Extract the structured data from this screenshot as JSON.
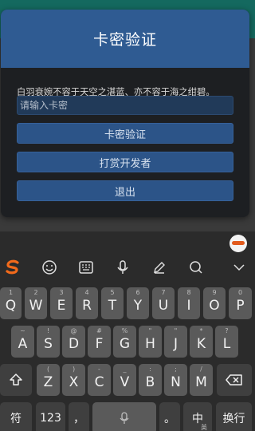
{
  "dialog": {
    "title": "卡密验证",
    "message": "白羽衰婉不容于天空之湛蓝、亦不容于海之绀碧。",
    "input_placeholder": "请输入卡密",
    "buttons": {
      "verify": "卡密验证",
      "reward": "打赏开发者",
      "exit": "退出"
    }
  },
  "keyboard": {
    "toolbar_icons": [
      "sogou-logo-icon",
      "emoji-icon",
      "keyboard-icon",
      "microphone-icon",
      "pen-icon",
      "search-icon",
      "chevron-down-icon"
    ],
    "row1": [
      {
        "key": "Q",
        "sub": "1"
      },
      {
        "key": "W",
        "sub": "2"
      },
      {
        "key": "E",
        "sub": "3"
      },
      {
        "key": "R",
        "sub": "4"
      },
      {
        "key": "T",
        "sub": "5"
      },
      {
        "key": "Y",
        "sub": "6"
      },
      {
        "key": "U",
        "sub": "7"
      },
      {
        "key": "I",
        "sub": "8"
      },
      {
        "key": "O",
        "sub": "9"
      },
      {
        "key": "P",
        "sub": "0"
      }
    ],
    "row2": [
      {
        "key": "A",
        "sub": "~"
      },
      {
        "key": "S",
        "sub": "!"
      },
      {
        "key": "D",
        "sub": "@"
      },
      {
        "key": "F",
        "sub": "#"
      },
      {
        "key": "G",
        "sub": "%"
      },
      {
        "key": "H",
        "sub": "\""
      },
      {
        "key": "J",
        "sub": "\""
      },
      {
        "key": "K",
        "sub": "*"
      },
      {
        "key": "L",
        "sub": "?"
      }
    ],
    "row3": [
      {
        "key": "Z",
        "sub": "("
      },
      {
        "key": "X",
        "sub": ")"
      },
      {
        "key": "C",
        "sub": "-"
      },
      {
        "key": "V",
        "sub": "_"
      },
      {
        "key": "B",
        "sub": ":"
      },
      {
        "key": "N",
        "sub": ";"
      },
      {
        "key": "M",
        "sub": "/"
      }
    ],
    "bottom": {
      "symbol": "符",
      "numbers": "123",
      "comma": "，",
      "period": "。",
      "lang": "中",
      "lang_alt": "英",
      "enter": "换行"
    }
  },
  "colors": {
    "dialog_header": "#2f5b92",
    "button": "#2c5488",
    "key": "#5a5a5a",
    "key_dark": "#3f3f3f",
    "sogou_orange": "#f26a1b"
  }
}
